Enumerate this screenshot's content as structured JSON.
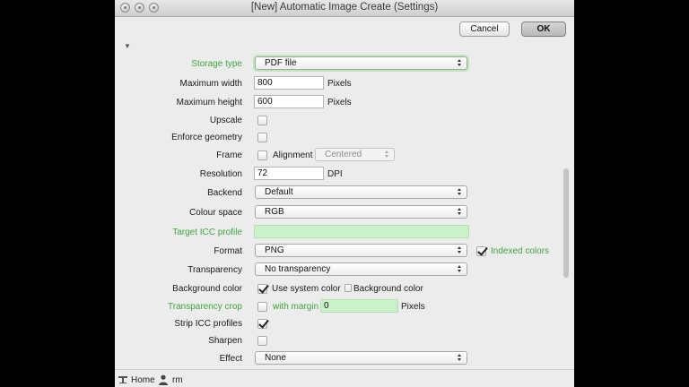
{
  "window": {
    "title": "[New] Automatic Image Create (Settings)"
  },
  "buttons": {
    "cancel": "Cancel",
    "ok": "OK"
  },
  "rows": {
    "storage_type": {
      "label": "Storage type",
      "value": "PDF file"
    },
    "max_width": {
      "label": "Maximum width",
      "value": "800",
      "unit": "Pixels"
    },
    "max_height": {
      "label": "Maximum height",
      "value": "600",
      "unit": "Pixels"
    },
    "upscale": {
      "label": "Upscale",
      "checked": false
    },
    "enforce_geometry": {
      "label": "Enforce geometry",
      "checked": false
    },
    "frame": {
      "label": "Frame",
      "checked": false,
      "alignment_label": "Alignment",
      "alignment_value": "Centered"
    },
    "resolution": {
      "label": "Resolution",
      "value": "72",
      "unit": "DPI"
    },
    "backend": {
      "label": "Backend",
      "value": "Default"
    },
    "colour_space": {
      "label": "Colour space",
      "value": "RGB"
    },
    "target_icc": {
      "label": "Target ICC profile",
      "value": ""
    },
    "format": {
      "label": "Format",
      "value": "PNG",
      "indexed_label": "Indexed colors",
      "indexed_checked": true
    },
    "transparency": {
      "label": "Transparency",
      "value": "No transparency"
    },
    "background_color": {
      "label": "Background color",
      "system_label": "Use system color",
      "system_checked": true,
      "custom_label": "Background color"
    },
    "transparency_crop": {
      "label": "Transparency crop",
      "checked": false,
      "margin_label": "with margin",
      "margin_value": "0",
      "unit": "Pixels"
    },
    "strip_icc": {
      "label": "Strip ICC profiles",
      "checked": true
    },
    "sharpen": {
      "label": "Sharpen",
      "checked": false
    },
    "effect": {
      "label": "Effect",
      "value": "None"
    }
  },
  "status": {
    "location": "Home",
    "user": "rm"
  },
  "colors": {
    "accent_green": "#3ea63e",
    "field_green": "#c9f2c9"
  }
}
